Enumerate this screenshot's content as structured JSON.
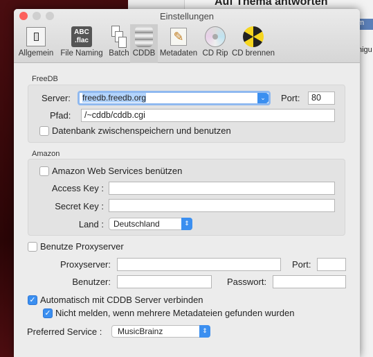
{
  "background": {
    "window_title": "Auf Thema antworten",
    "fragment_1": "m",
    "fragment_2": "nigu"
  },
  "window": {
    "title": "Einstellungen"
  },
  "toolbar": {
    "items": [
      {
        "label": "Allgemein",
        "icon": "switch-icon"
      },
      {
        "label": "File Naming",
        "icon": "abc-flac-icon",
        "icon_text": "ABC .flac"
      },
      {
        "label": "Batch",
        "icon": "documents-icon"
      },
      {
        "label": "CDDB",
        "icon": "database-icon",
        "selected": true
      },
      {
        "label": "Metadaten",
        "icon": "pencil-document-icon"
      },
      {
        "label": "CD Rip",
        "icon": "cd-icon"
      },
      {
        "label": "CD brennen",
        "icon": "radiation-icon"
      }
    ]
  },
  "freedb": {
    "section": "FreeDB",
    "server_label": "Server:",
    "server_value": "freedb.freedb.org",
    "port_label": "Port:",
    "port_value": "80",
    "path_label": "Pfad:",
    "path_value": "/~cddb/cddb.cgi",
    "cache_label": "Datenbank zwischenspeichern und benutzen",
    "cache_checked": false
  },
  "amazon": {
    "section": "Amazon",
    "aws_label": "Amazon Web Services benützen",
    "aws_checked": false,
    "access_key_label": "Access Key :",
    "access_key_value": "",
    "secret_key_label": "Secret Key :",
    "secret_key_value": "",
    "country_label": "Land :",
    "country_value": "Deutschland"
  },
  "proxy": {
    "use_label": "Benutze Proxyserver",
    "use_checked": false,
    "server_label": "Proxyserver:",
    "port_label": "Port:",
    "user_label": "Benutzer:",
    "password_label": "Passwort:"
  },
  "auto_connect": {
    "label": "Automatisch mit CDDB Server verbinden",
    "checked": true
  },
  "no_notify": {
    "label": "Nicht melden, wenn mehrere Metadateien gefunden wurden",
    "checked": true
  },
  "preferred": {
    "label": "Preferred Service :",
    "value": "MusicBrainz"
  },
  "colors": {
    "accent": "#3b8ff0",
    "close": "#fc605c"
  }
}
